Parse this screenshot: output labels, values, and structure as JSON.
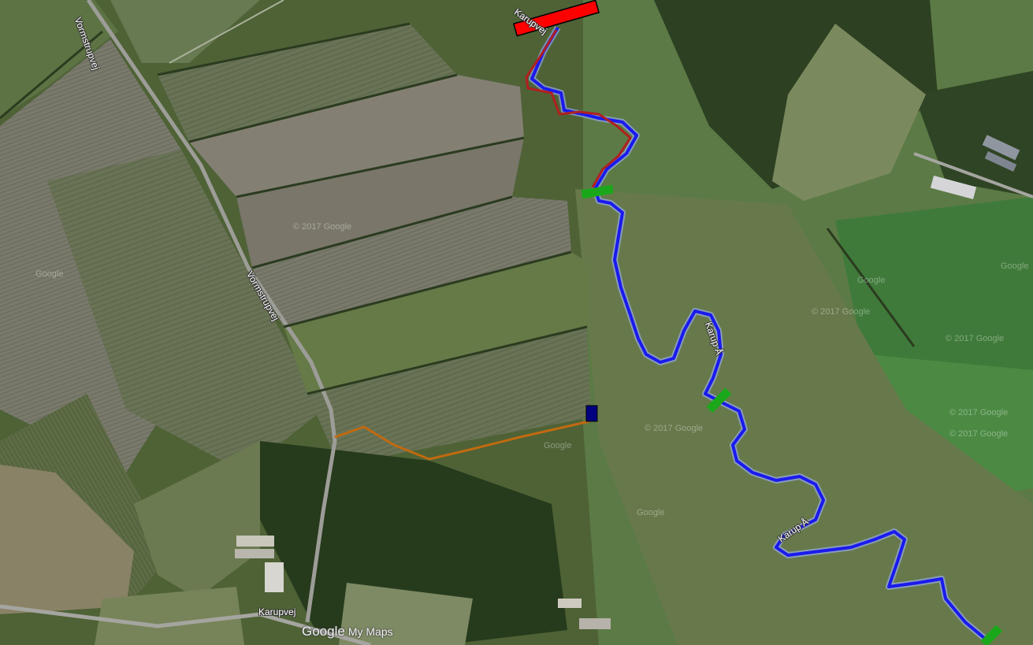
{
  "map": {
    "road_labels": {
      "vormstrupvej_left": "Vormstrupvej",
      "vormstrupvej_mid": "Vormstrupvej",
      "karupvej": "Karupvej",
      "karupvej_top": "Karupvej"
    },
    "river_labels": {
      "karup_a_upper": "Karup Å",
      "karup_a_lower": "Karup Å"
    },
    "branding": {
      "google": "Google",
      "my_maps": "My Maps"
    },
    "watermark": "© 2017 Google",
    "watermark_short": "Google",
    "colors": {
      "route_main": "#1a1aee",
      "route_upper": "#b02020",
      "route_access": "#c06a10",
      "marker_block": "#ff0000",
      "marker_bar": "#1aa81a",
      "marker_square": "#000080"
    },
    "icons": [
      "red-bar-marker",
      "green-bar-marker",
      "navy-square-marker"
    ]
  }
}
